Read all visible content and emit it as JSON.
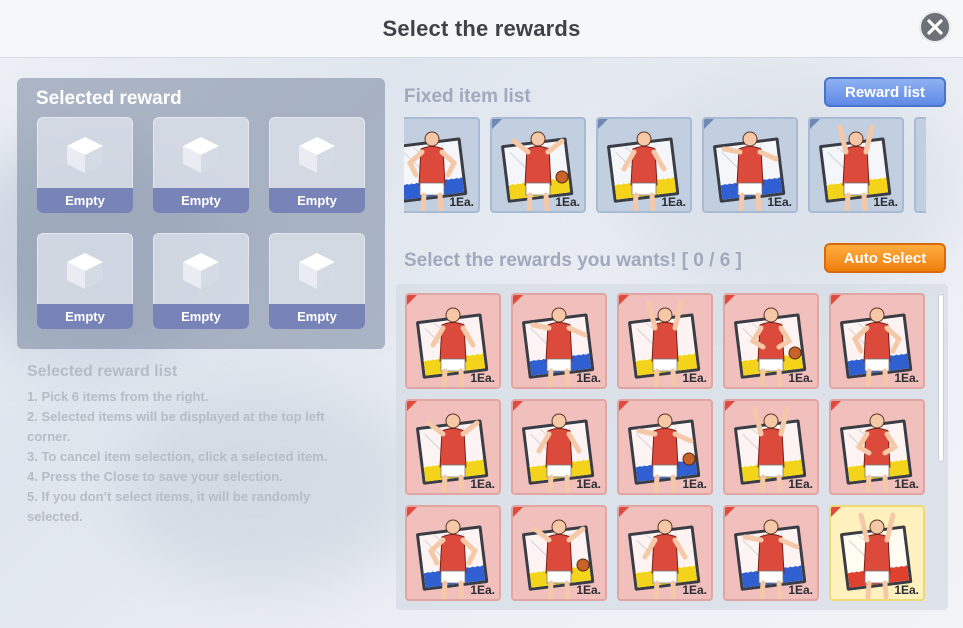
{
  "title": "Select the rewards",
  "close_icon": "close-icon",
  "selected_panel": {
    "heading": "Selected reward",
    "slots": [
      {
        "label": "Empty",
        "icon": "cube-icon"
      },
      {
        "label": "Empty",
        "icon": "cube-icon"
      },
      {
        "label": "Empty",
        "icon": "cube-icon"
      },
      {
        "label": "Empty",
        "icon": "cube-icon"
      },
      {
        "label": "Empty",
        "icon": "cube-icon"
      },
      {
        "label": "Empty",
        "icon": "cube-icon"
      }
    ]
  },
  "instructions": {
    "title": "Selected reward list",
    "lines": [
      "1. Pick 6 items from the right.",
      "2. Selected items will be displayed at the top left",
      "corner.",
      "3. To cancel item selection, click a selected item.",
      "4. Press the Close to save your selection.",
      "5. If you don’t select items, it will be randomly",
      "selected."
    ]
  },
  "fixed": {
    "heading": "Fixed item list",
    "button": "Reward list",
    "items": [
      {
        "qty": "1Ea.",
        "pose": "player-card-icon",
        "color": "blue"
      },
      {
        "qty": "1Ea.",
        "pose": "player-card-icon",
        "color": "blue"
      },
      {
        "qty": "1Ea.",
        "pose": "player-card-icon",
        "color": "blue"
      },
      {
        "qty": "1Ea.",
        "pose": "player-card-icon",
        "color": "blue"
      },
      {
        "qty": "1Ea.",
        "pose": "player-card-icon",
        "color": "blue"
      }
    ]
  },
  "choose": {
    "heading": "Select the rewards you wants! [ 0 / 6 ]",
    "button": "Auto Select",
    "items": [
      {
        "qty": "1Ea.",
        "color": "pink"
      },
      {
        "qty": "1Ea.",
        "color": "pink"
      },
      {
        "qty": "1Ea.",
        "color": "pink"
      },
      {
        "qty": "1Ea.",
        "color": "pink"
      },
      {
        "qty": "1Ea.",
        "color": "pink"
      },
      {
        "qty": "1Ea.",
        "color": "pink"
      },
      {
        "qty": "1Ea.",
        "color": "pink"
      },
      {
        "qty": "1Ea.",
        "color": "pink"
      },
      {
        "qty": "1Ea.",
        "color": "pink"
      },
      {
        "qty": "1Ea.",
        "color": "pink"
      },
      {
        "qty": "1Ea.",
        "color": "pink"
      },
      {
        "qty": "1Ea.",
        "color": "pink"
      },
      {
        "qty": "1Ea.",
        "color": "pink"
      },
      {
        "qty": "1Ea.",
        "color": "pink"
      },
      {
        "qty": "1Ea.",
        "color": "gold"
      }
    ]
  },
  "colors": {
    "reward_list_button": "#6d96ea",
    "auto_select_button": "#f08a1c",
    "slot_label_bg": "#7884b7",
    "jersey": "#dc4a3c"
  }
}
